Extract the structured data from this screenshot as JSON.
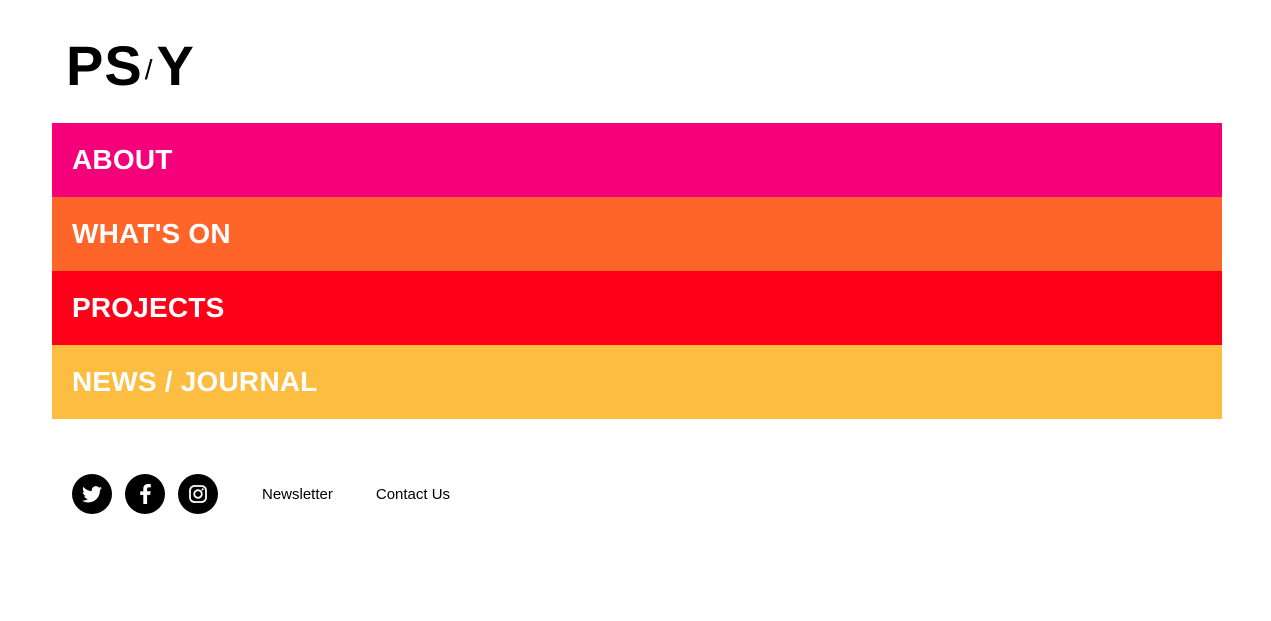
{
  "logo": {
    "left": "PS",
    "slash": "/",
    "right": "Y",
    "color": "#000000"
  },
  "menu": {
    "items": [
      {
        "label": "ABOUT",
        "color": "#f5007a"
      },
      {
        "label": "WHAT'S ON",
        "color": "#ff6429"
      },
      {
        "label": "PROJECTS",
        "color": "#ff0019"
      },
      {
        "label": "NEWS / JOURNAL",
        "color": "#fcbd40"
      }
    ]
  },
  "footer": {
    "social": [
      {
        "icon": "twitter-icon"
      },
      {
        "icon": "facebook-icon"
      },
      {
        "icon": "instagram-icon"
      }
    ],
    "links": [
      {
        "label": "Newsletter"
      },
      {
        "label": "Contact Us"
      }
    ]
  }
}
